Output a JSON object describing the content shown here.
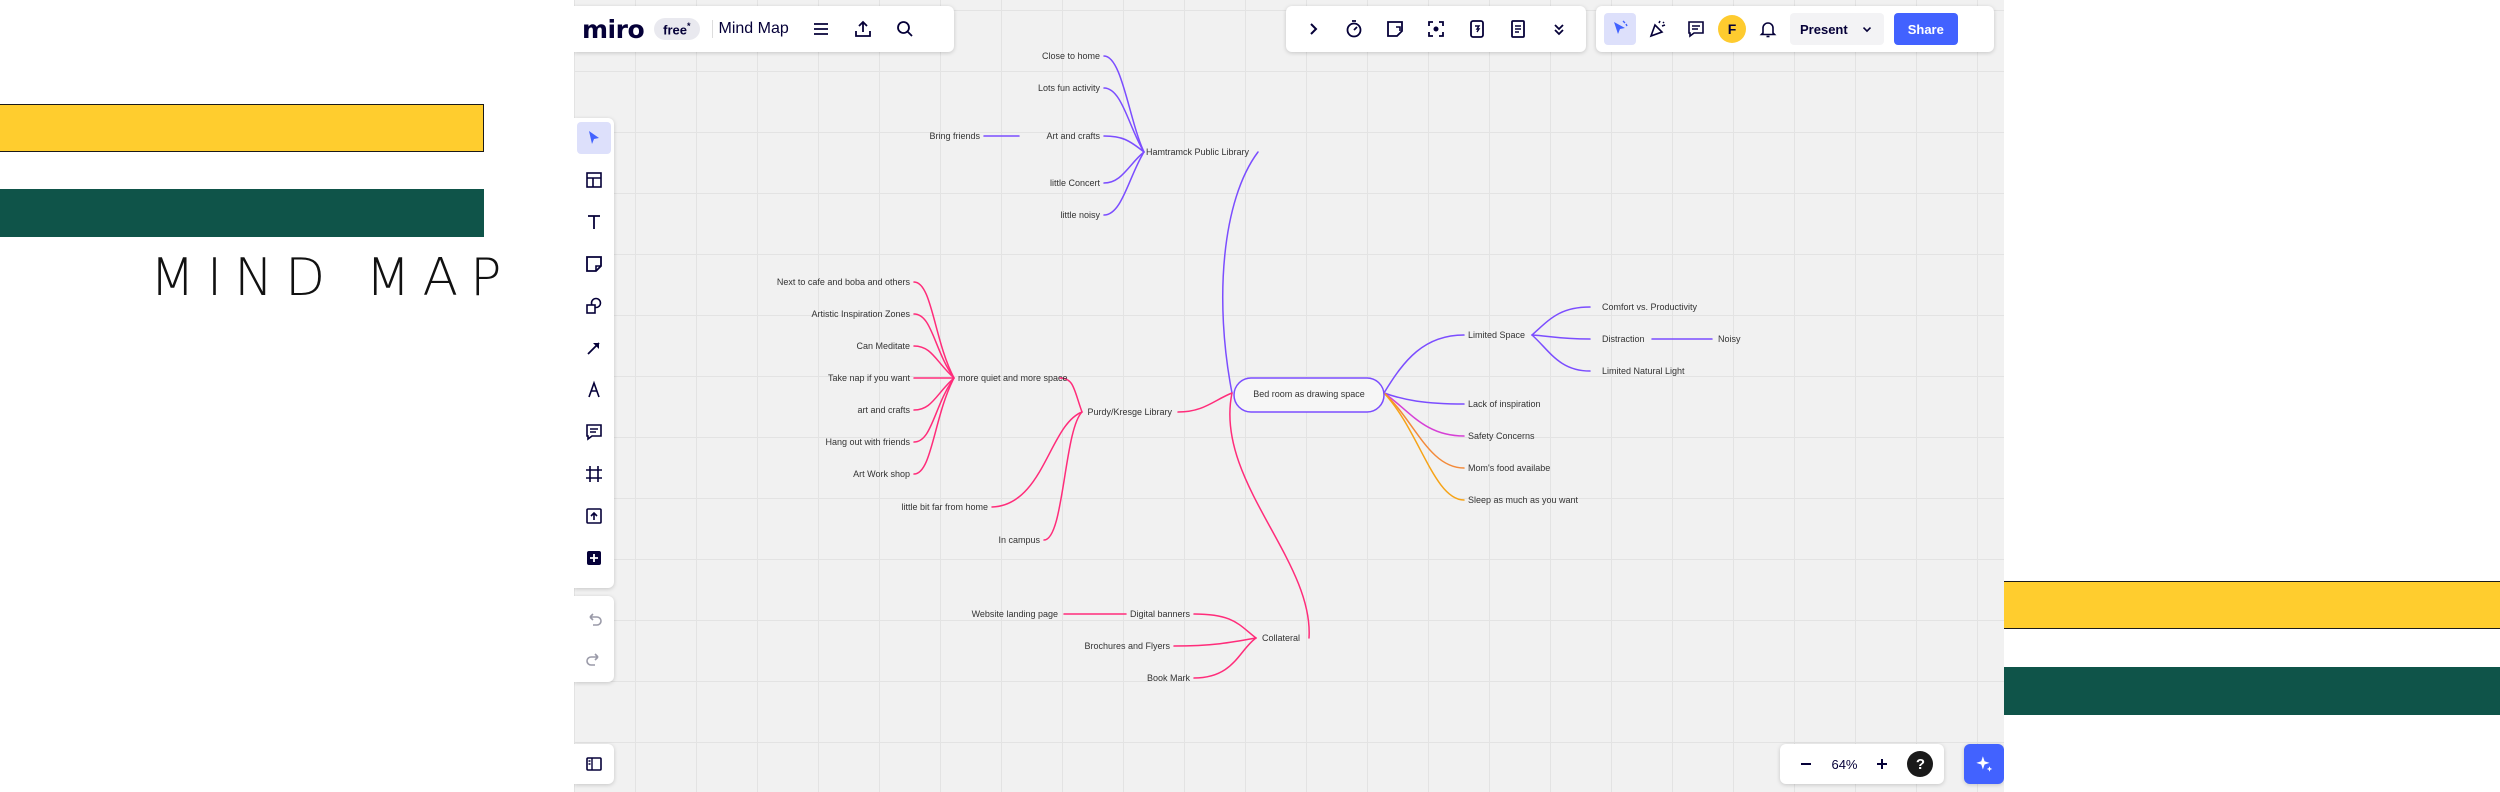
{
  "slide": {
    "title": "MIND MAP",
    "colors": {
      "yellow": "#ffcd2e",
      "green": "#0f5449"
    }
  },
  "app": {
    "logo": "miro",
    "plan": "free",
    "plan_marker": "*",
    "board_name": "Mind Map",
    "avatar_initial": "F",
    "present_label": "Present",
    "share_label": "Share",
    "zoom": "64%",
    "help_label": "?",
    "accent": "#4262ff"
  },
  "toolbar": {
    "top_left": [
      "hamburger-icon",
      "upload-icon",
      "search-icon"
    ],
    "top_tools": [
      "chevron-right-icon",
      "timer-icon",
      "sticky-add-icon",
      "focus-icon",
      "counter-icon",
      "notes-icon",
      "chevron-down-icon"
    ],
    "top_right": [
      "cursor-icon",
      "celebrate-icon",
      "comment-icon",
      "bell-icon"
    ],
    "left": [
      "select-icon",
      "template-icon",
      "text-icon",
      "sticky-note-icon",
      "shapes-icon",
      "connector-icon",
      "pen-icon",
      "comment-icon",
      "frame-icon",
      "upload-icon",
      "add-icon"
    ],
    "history": [
      "undo-icon",
      "redo-icon"
    ]
  },
  "mindmap": {
    "center": "Bed room as drawing space",
    "branch_colors": {
      "purple": "#7b4dff",
      "pink": "#ff2c7a",
      "orange": "#f6a317"
    },
    "hamtramck": {
      "label": "Hamtramck Public Library",
      "children": [
        "Close to  home",
        "Lots fun activity",
        "Art and crafts",
        "little Concert",
        "little noisy"
      ],
      "grandchild": "Bring friends"
    },
    "purdy": {
      "label": "Purdy/Kresge Library",
      "children": [
        "more quiet and more space",
        "little bit far from home",
        "In campus"
      ],
      "quiet_children": [
        "Next to cafe and boba  and others",
        "Artistic Inspiration Zones",
        "Can Meditate",
        "Take nap if you want",
        "art and crafts",
        "Hang out with friends",
        "Art Work shop"
      ]
    },
    "collateral": {
      "label": "Collateral",
      "children": [
        "Digital banners",
        "Brochures and Flyers",
        "Book Mark"
      ],
      "grandchild": "Website landing page"
    },
    "limited_space": {
      "label": "Limited Space",
      "children": [
        "Comfort vs. Productivity",
        "Distraction",
        "Limited Natural Light"
      ],
      "grandchild": "Noisy"
    },
    "right_items": [
      "Lack of inspiration",
      "Safety Concerns",
      "Mom's food availabe",
      "Sleep as much as you want"
    ]
  }
}
